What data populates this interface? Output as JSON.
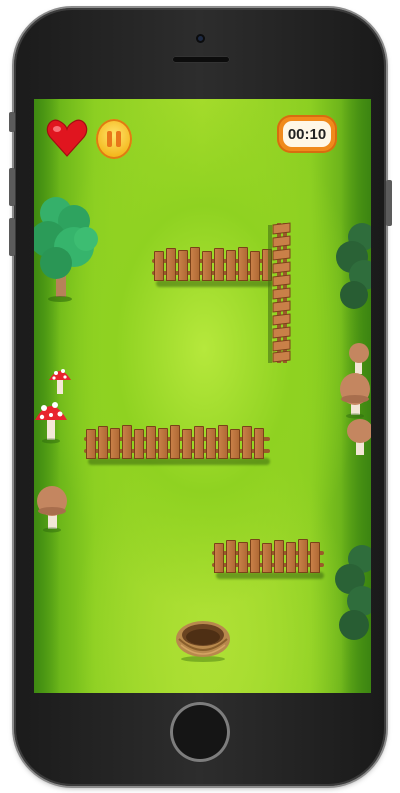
{
  "hud": {
    "timer_text": "00:10",
    "lives_icon": "heart-icon",
    "pause_icon": "pause-icon"
  },
  "scene": {
    "fences": [
      {
        "name": "fence-upper",
        "orientation": "horizontal"
      },
      {
        "name": "fence-upper-vertical",
        "orientation": "vertical"
      },
      {
        "name": "fence-middle",
        "orientation": "horizontal"
      },
      {
        "name": "fence-lower",
        "orientation": "horizontal"
      }
    ],
    "goal": "nest-icon"
  },
  "colors": {
    "grass_light": "#b6e83c",
    "grass_dark": "#3f8a12",
    "fence_wood": "#c98048",
    "timer_orange": "#f08a1c",
    "heart_red": "#e0151f",
    "pause_yellow": "#ffd23f"
  }
}
